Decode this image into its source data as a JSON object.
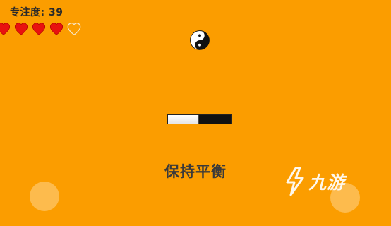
{
  "hud": {
    "focus_text": "专注度: 39",
    "lives_total": 5,
    "lives_remaining": 4
  },
  "balance": {
    "left_fraction": 0.48
  },
  "instruction": "保持平衡",
  "watermark": {
    "text": "九游"
  },
  "colors": {
    "background": "#FB9D00",
    "heart": "#E8110F",
    "heart_empty_outline": "#F7E6C8"
  },
  "icons": {
    "center": "yin-yang-icon",
    "lives": "heart-icon"
  }
}
